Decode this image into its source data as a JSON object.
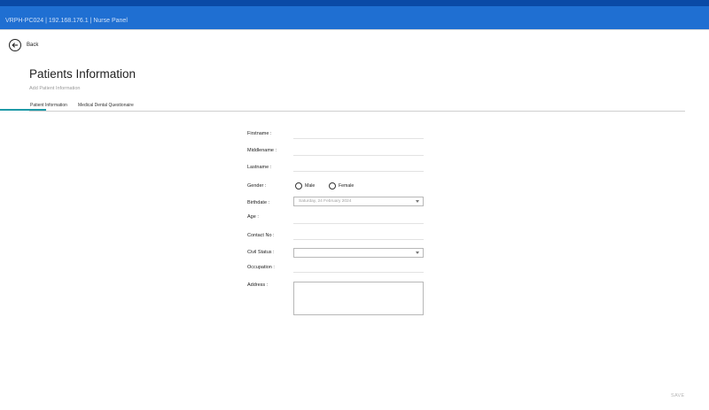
{
  "window": {
    "title": "VRPH-PC024 | 192.168.176.1 | Nurse Panel"
  },
  "nav": {
    "back_label": "Back"
  },
  "page": {
    "title": "Patients Information",
    "subtitle": "Add Patient Information"
  },
  "tabs": [
    {
      "label": "Patient Information",
      "active": true
    },
    {
      "label": "Medical Dental Questionaire",
      "active": false
    }
  ],
  "form": {
    "firstname_label": "Firstname :",
    "middlename_label": "Middlename :",
    "lastname_label": "Lastname :",
    "gender_label": "Gender :",
    "gender_options": [
      "Male",
      "Female"
    ],
    "birthdate_label": "Birthdate :",
    "birthdate_value": "Saturday, 24 February 2024",
    "age_label": "Age :",
    "contact_label": "Contact No :",
    "civil_status_label": "Civil Status :",
    "civil_status_value": "",
    "occupation_label": "Occupation :",
    "address_label": "Address :"
  },
  "actions": {
    "save_label": "SAVE"
  },
  "colors": {
    "titlebar": "#1f6fd2",
    "topstrip": "#0a4aa6",
    "tab_accent": "#1e9aa7"
  },
  "icons": {
    "back": "arrow-left-circle-icon",
    "dropdown": "chevron-down-icon"
  }
}
